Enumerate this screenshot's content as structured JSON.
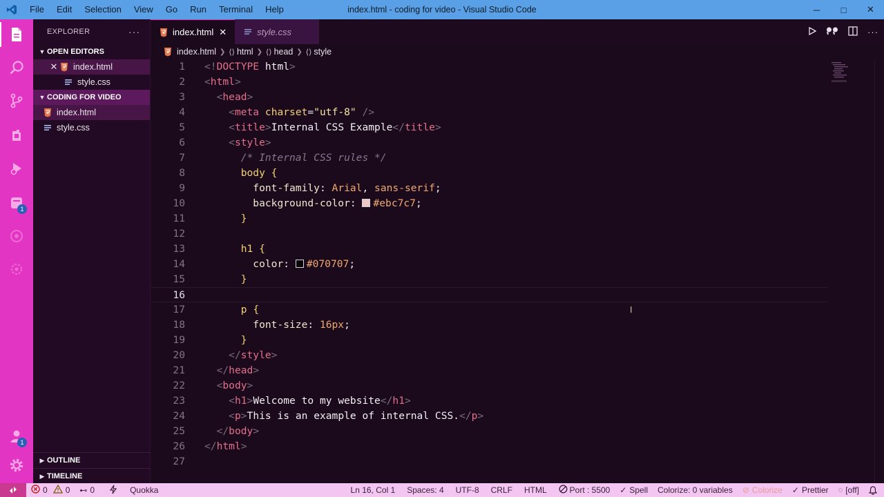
{
  "titlebar": {
    "menu": [
      "File",
      "Edit",
      "Selection",
      "View",
      "Go",
      "Run",
      "Terminal",
      "Help"
    ],
    "title": "index.html - coding for video - Visual Studio Code",
    "controls": {
      "minimize": "─",
      "maximize": "□",
      "close": "✕"
    }
  },
  "activitybar": {
    "items": [
      {
        "name": "explorer-icon"
      },
      {
        "name": "search-icon"
      },
      {
        "name": "source-control-icon"
      },
      {
        "name": "extensions-icon"
      },
      {
        "name": "run-debug-icon"
      },
      {
        "name": "remote-icon",
        "badge": "1"
      },
      {
        "name": "live-share-icon"
      },
      {
        "name": "testing-icon"
      }
    ],
    "accounts_badge": "1"
  },
  "sidebar": {
    "header": "EXPLORER",
    "more": "···",
    "open_editors_label": "OPEN EDITORS",
    "open_editors": [
      {
        "name": "index.html",
        "close": "✕"
      },
      {
        "name": "style.css"
      }
    ],
    "workspace_label": "CODING FOR VIDEO",
    "workspace_files": [
      "index.html",
      "style.css"
    ],
    "outline_label": "OUTLINE",
    "timeline_label": "TIMELINE"
  },
  "tabs": [
    {
      "label": "index.html",
      "active": true,
      "close": "✕"
    },
    {
      "label": "style.css",
      "active": false
    }
  ],
  "breadcrumb": [
    "index.html",
    "html",
    "head",
    "style"
  ],
  "editor": {
    "current_line": 16,
    "lines": [
      {
        "n": "1",
        "tokens": [
          [
            "b",
            "<!"
          ],
          [
            "tag",
            "DOCTYPE"
          ],
          [
            "text",
            " html"
          ],
          [
            "b",
            ">"
          ]
        ]
      },
      {
        "n": "2",
        "tokens": [
          [
            "b",
            "<"
          ],
          [
            "tag",
            "html"
          ],
          [
            "b",
            ">"
          ]
        ]
      },
      {
        "n": "3",
        "tokens": [
          [
            "text",
            "  "
          ],
          [
            "b",
            "<"
          ],
          [
            "tag",
            "head"
          ],
          [
            "b",
            ">"
          ]
        ]
      },
      {
        "n": "4",
        "tokens": [
          [
            "text",
            "    "
          ],
          [
            "b",
            "<"
          ],
          [
            "tag",
            "meta"
          ],
          [
            "text",
            " "
          ],
          [
            "attr",
            "charset"
          ],
          [
            "text",
            "="
          ],
          [
            "str",
            "\"utf-8\""
          ],
          [
            "text",
            " "
          ],
          [
            "b",
            "/>"
          ]
        ]
      },
      {
        "n": "5",
        "tokens": [
          [
            "text",
            "    "
          ],
          [
            "b",
            "<"
          ],
          [
            "tag",
            "title"
          ],
          [
            "b",
            ">"
          ],
          [
            "text",
            "Internal CSS Example"
          ],
          [
            "b",
            "</"
          ],
          [
            "tag",
            "title"
          ],
          [
            "b",
            ">"
          ]
        ]
      },
      {
        "n": "6",
        "tokens": [
          [
            "text",
            "    "
          ],
          [
            "b",
            "<"
          ],
          [
            "tag",
            "style"
          ],
          [
            "b",
            ">"
          ]
        ]
      },
      {
        "n": "7",
        "tokens": [
          [
            "text",
            "      "
          ],
          [
            "cm",
            "/* Internal CSS rules */"
          ]
        ]
      },
      {
        "n": "8",
        "tokens": [
          [
            "text",
            "      "
          ],
          [
            "sel",
            "body"
          ],
          [
            "text",
            " "
          ],
          [
            "br",
            "{"
          ]
        ]
      },
      {
        "n": "9",
        "tokens": [
          [
            "text",
            "        "
          ],
          [
            "prop",
            "font-family"
          ],
          [
            "text",
            ": "
          ],
          [
            "val",
            "Arial"
          ],
          [
            "text",
            ", "
          ],
          [
            "val",
            "sans-serif"
          ],
          [
            "text",
            ";"
          ]
        ]
      },
      {
        "n": "10",
        "tokens": [
          [
            "text",
            "        "
          ],
          [
            "prop",
            "background-color"
          ],
          [
            "text",
            ": "
          ],
          [
            "swatch",
            "#ebc7c7"
          ],
          [
            "val",
            "#ebc7c7"
          ],
          [
            "text",
            ";"
          ]
        ]
      },
      {
        "n": "11",
        "tokens": [
          [
            "text",
            "      "
          ],
          [
            "br",
            "}"
          ]
        ]
      },
      {
        "n": "12",
        "tokens": []
      },
      {
        "n": "13",
        "tokens": [
          [
            "text",
            "      "
          ],
          [
            "sel",
            "h1"
          ],
          [
            "text",
            " "
          ],
          [
            "br",
            "{"
          ]
        ]
      },
      {
        "n": "14",
        "tokens": [
          [
            "text",
            "        "
          ],
          [
            "prop",
            "color"
          ],
          [
            "text",
            ": "
          ],
          [
            "swatch",
            "#070707"
          ],
          [
            "val",
            "#070707"
          ],
          [
            "text",
            ";"
          ]
        ]
      },
      {
        "n": "15",
        "tokens": [
          [
            "text",
            "      "
          ],
          [
            "br",
            "}"
          ]
        ]
      },
      {
        "n": "16",
        "tokens": []
      },
      {
        "n": "17",
        "tokens": [
          [
            "text",
            "      "
          ],
          [
            "sel",
            "p"
          ],
          [
            "text",
            " "
          ],
          [
            "br",
            "{"
          ]
        ]
      },
      {
        "n": "18",
        "tokens": [
          [
            "text",
            "        "
          ],
          [
            "prop",
            "font-size"
          ],
          [
            "text",
            ": "
          ],
          [
            "val",
            "16px"
          ],
          [
            "text",
            ";"
          ]
        ]
      },
      {
        "n": "19",
        "tokens": [
          [
            "text",
            "      "
          ],
          [
            "br",
            "}"
          ]
        ]
      },
      {
        "n": "20",
        "tokens": [
          [
            "text",
            "    "
          ],
          [
            "b",
            "</"
          ],
          [
            "tag",
            "style"
          ],
          [
            "b",
            ">"
          ]
        ]
      },
      {
        "n": "21",
        "tokens": [
          [
            "text",
            "  "
          ],
          [
            "b",
            "</"
          ],
          [
            "tag",
            "head"
          ],
          [
            "b",
            ">"
          ]
        ]
      },
      {
        "n": "22",
        "tokens": [
          [
            "text",
            "  "
          ],
          [
            "b",
            "<"
          ],
          [
            "tag",
            "body"
          ],
          [
            "b",
            ">"
          ]
        ]
      },
      {
        "n": "23",
        "tokens": [
          [
            "text",
            "    "
          ],
          [
            "b",
            "<"
          ],
          [
            "tag",
            "h1"
          ],
          [
            "b",
            ">"
          ],
          [
            "text",
            "Welcome to my website"
          ],
          [
            "b",
            "</"
          ],
          [
            "tag",
            "h1"
          ],
          [
            "b",
            ">"
          ]
        ]
      },
      {
        "n": "24",
        "tokens": [
          [
            "text",
            "    "
          ],
          [
            "b",
            "<"
          ],
          [
            "tag",
            "p"
          ],
          [
            "b",
            ">"
          ],
          [
            "text",
            "This is an example of internal CSS."
          ],
          [
            "b",
            "</"
          ],
          [
            "tag",
            "p"
          ],
          [
            "b",
            ">"
          ]
        ]
      },
      {
        "n": "25",
        "tokens": [
          [
            "text",
            "  "
          ],
          [
            "b",
            "</"
          ],
          [
            "tag",
            "body"
          ],
          [
            "b",
            ">"
          ]
        ]
      },
      {
        "n": "26",
        "tokens": [
          [
            "b",
            "</"
          ],
          [
            "tag",
            "html"
          ],
          [
            "b",
            ">"
          ]
        ]
      },
      {
        "n": "27",
        "tokens": []
      }
    ]
  },
  "statusbar": {
    "errors": "0",
    "warnings": "0",
    "ports": "0",
    "quokka": "Quokka",
    "position": "Ln 16, Col 1",
    "spaces": "Spaces: 4",
    "encoding": "UTF-8",
    "eol": "CRLF",
    "language": "HTML",
    "port": "Port : 5500",
    "spell": "Spell",
    "colorize_vars": "Colorize: 0 variables",
    "colorize": "Colorize",
    "prettier": "Prettier",
    "off": "[off]"
  },
  "colors": {
    "titlebar": "#5aa0e6",
    "activitybar": "#e335c3",
    "sidebar": "#230a24",
    "editor": "#1b0a1b",
    "statusbar": "#f2c6f0"
  }
}
